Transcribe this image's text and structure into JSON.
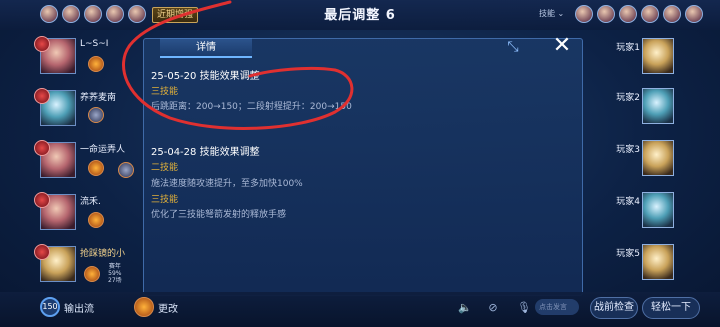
{
  "header": {
    "title": "最后调整 6",
    "recent_buff_label": "近期增强",
    "skill_select_label": "技能",
    "skill_select_caret": "⌄"
  },
  "left_players": [
    {
      "name": "L~S~I"
    },
    {
      "name": "养荞麦南"
    },
    {
      "name": "一命运弄人"
    },
    {
      "name": "流禾."
    },
    {
      "name": "抢踩镜的小"
    }
  ],
  "self_stats": {
    "line1": "赛年",
    "line2": "59%",
    "line3": "27场"
  },
  "right_players": [
    {
      "name": "玩家1"
    },
    {
      "name": "玩家2"
    },
    {
      "name": "玩家3"
    },
    {
      "name": "玩家4"
    },
    {
      "name": "玩家5"
    }
  ],
  "dialog": {
    "tab_label": "详情",
    "expand_icon": "⤡",
    "close_icon": "✕",
    "entries": [
      {
        "date_title": "25-05-20 技能效果调整",
        "items": [
          {
            "skill": "三技能",
            "detail": "后跳距离：200→150；二段射程提升：200→150"
          }
        ]
      },
      {
        "date_title": "25-04-28 技能效果调整",
        "items": [
          {
            "skill": "二技能",
            "detail": "施法速度随攻速提升，至多加快100%"
          },
          {
            "skill": "三技能",
            "detail": "优化了三技能弩箭发射的释放手感"
          }
        ]
      }
    ]
  },
  "bottom": {
    "level": "150",
    "lane_label": "输出流",
    "change_label": "更改",
    "chat_placeholder": "点击发言",
    "battle_check_label": "战前检查",
    "easy_button_label": "轻松一下"
  },
  "colors": {
    "accent_gold": "#e2b13a",
    "tab_underline": "#6fb6ff",
    "scribble_red": "#e03030"
  }
}
